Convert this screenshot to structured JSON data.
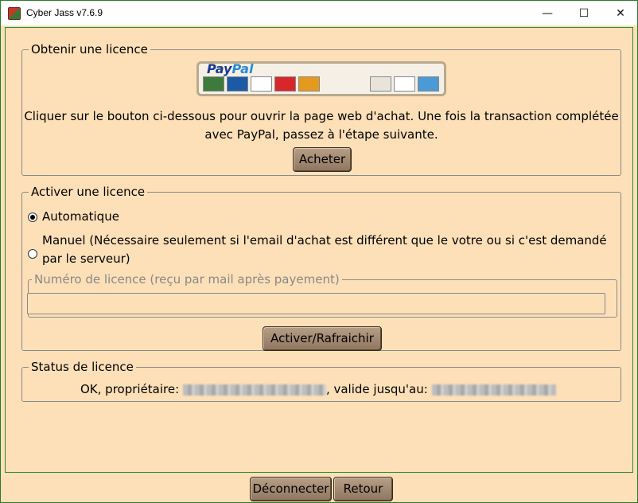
{
  "window": {
    "title": "Cyber Jass v7.6.9",
    "minimize_glyph": "—",
    "maximize_glyph": "☐",
    "close_glyph": "✕"
  },
  "obtain": {
    "legend": "Obtenir une licence",
    "paypal_logo_part1": "Pay",
    "paypal_logo_part2": "Pal",
    "instructions_line1": "Cliquer sur le bouton ci-dessous pour ouvrir la page web d'achat. Une fois la transaction complétée",
    "instructions_line2": "avec PayPal, passez à l'étape suivante.",
    "buy_button": "Acheter"
  },
  "activate": {
    "legend": "Activer une licence",
    "option_auto": "Automatique",
    "option_manual_line1": "Manuel (Nécessaire seulement si l'email d'achat est différent que le votre ou si c'est demandé",
    "option_manual_line2": "par le serveur)",
    "selected_option": "auto",
    "license_number_legend": "Numéro de licence (reçu par mail après payement)",
    "license_number_value": "",
    "activate_button": "Activer/Rafraichir"
  },
  "status": {
    "legend": "Status de licence",
    "prefix": "OK, propriétaire:",
    "middle": ", valide jusqu'au:"
  },
  "footer": {
    "disconnect_button": "Déconnecter",
    "back_button": "Retour"
  },
  "colors": {
    "background": "#fde0b8",
    "button": "#a88f78",
    "frame_border": "#2e8b2e"
  }
}
